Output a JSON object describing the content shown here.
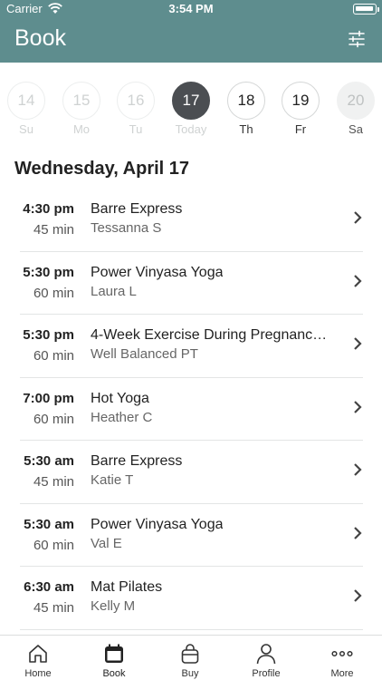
{
  "status": {
    "carrier": "Carrier",
    "time": "3:54 PM"
  },
  "header": {
    "title": "Book",
    "filter_icon": "sliders-icon"
  },
  "days": [
    {
      "num": "14",
      "label": "Su",
      "state": "past"
    },
    {
      "num": "15",
      "label": "Mo",
      "state": "past"
    },
    {
      "num": "16",
      "label": "Tu",
      "state": "past"
    },
    {
      "num": "17",
      "label": "Today",
      "state": "today"
    },
    {
      "num": "18",
      "label": "Th",
      "state": "future"
    },
    {
      "num": "19",
      "label": "Fr",
      "state": "future"
    },
    {
      "num": "20",
      "label": "Sa",
      "state": "weekend"
    }
  ],
  "date_heading": "Wednesday, April 17",
  "classes": [
    {
      "time": "4:30 pm",
      "duration": "45 min",
      "name": "Barre Express",
      "instructor": "Tessanna S"
    },
    {
      "time": "5:30 pm",
      "duration": "60 min",
      "name": "Power Vinyasa Yoga",
      "instructor": "Laura L"
    },
    {
      "time": "5:30 pm",
      "duration": "60 min",
      "name": "4-Week Exercise During Pregnancy…",
      "instructor": "Well Balanced PT"
    },
    {
      "time": "7:00 pm",
      "duration": "60 min",
      "name": "Hot Yoga",
      "instructor": "Heather C"
    },
    {
      "time": "5:30 am",
      "duration": "45 min",
      "name": "Barre Express",
      "instructor": "Katie T"
    },
    {
      "time": "5:30 am",
      "duration": "60 min",
      "name": "Power Vinyasa Yoga",
      "instructor": "Val E"
    },
    {
      "time": "6:30 am",
      "duration": "45 min",
      "name": "Mat Pilates",
      "instructor": "Kelly M"
    }
  ],
  "tabs": [
    {
      "label": "Home",
      "icon": "home-icon"
    },
    {
      "label": "Book",
      "icon": "calendar-icon",
      "active": true
    },
    {
      "label": "Buy",
      "icon": "shopping-bag-icon"
    },
    {
      "label": "Profile",
      "icon": "person-icon"
    },
    {
      "label": "More",
      "icon": "ellipsis-icon"
    }
  ],
  "colors": {
    "header": "#5e8d8e",
    "today": "#4b4e52"
  }
}
